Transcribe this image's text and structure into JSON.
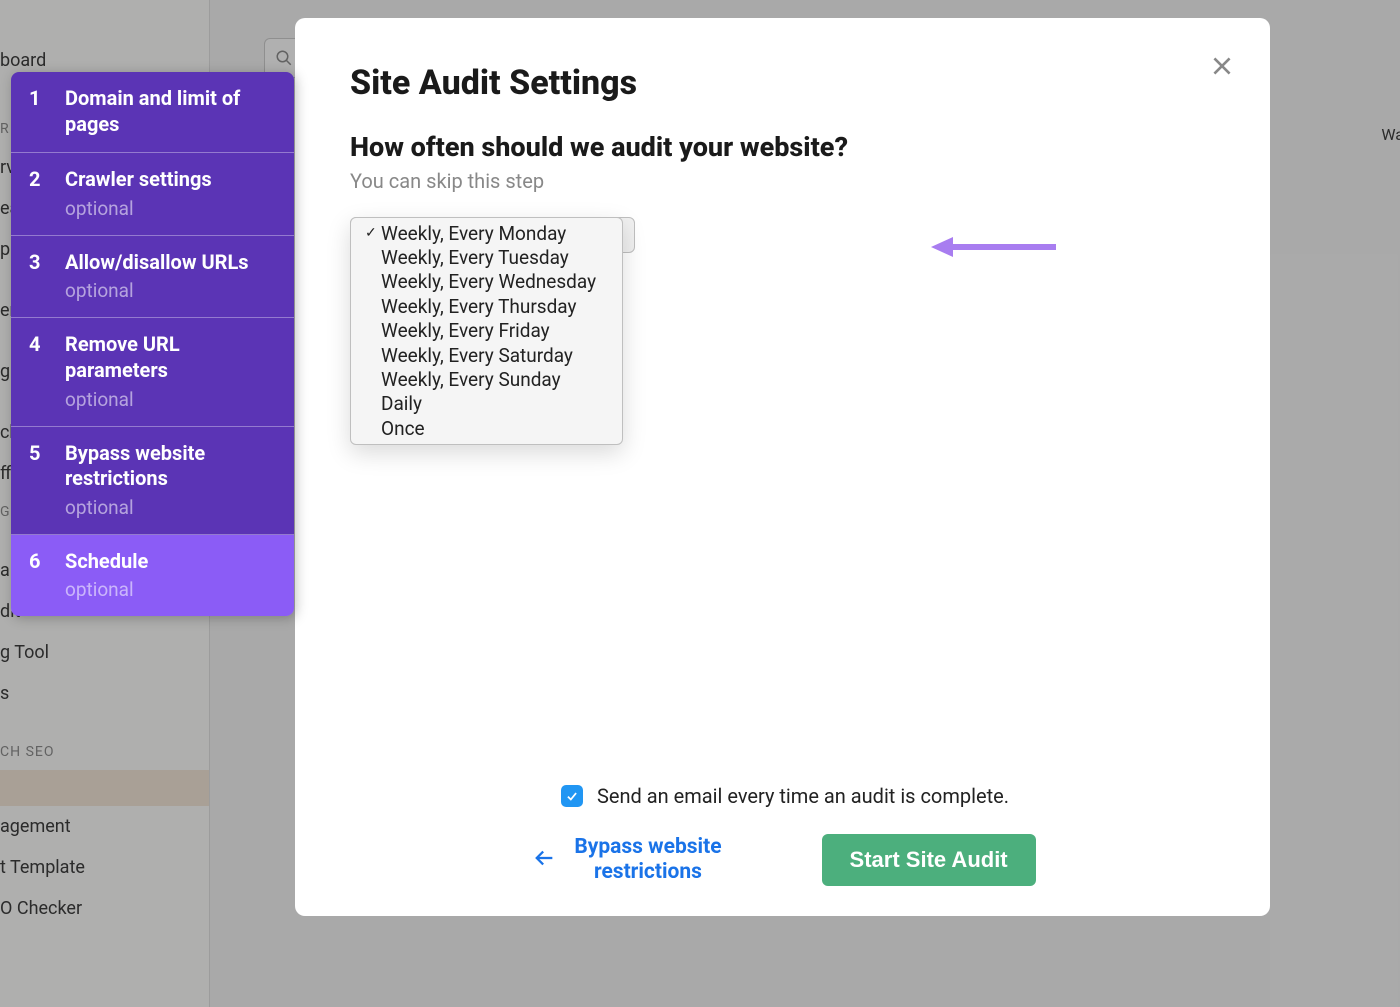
{
  "modal": {
    "title": "Site Audit Settings",
    "question": "How often should we audit your website?",
    "subtext": "You can skip this step"
  },
  "steps": [
    {
      "num": "1",
      "title": "Domain and limit of pages",
      "optional": ""
    },
    {
      "num": "2",
      "title": "Crawler settings",
      "optional": "optional"
    },
    {
      "num": "3",
      "title": "Allow/disallow URLs",
      "optional": "optional"
    },
    {
      "num": "4",
      "title": "Remove URL parameters",
      "optional": "optional"
    },
    {
      "num": "5",
      "title": "Bypass website restrictions",
      "optional": "optional"
    },
    {
      "num": "6",
      "title": "Schedule",
      "optional": "optional"
    }
  ],
  "active_step_index": 5,
  "dropdown": {
    "options": [
      "Weekly, Every Monday",
      "Weekly, Every Tuesday",
      "Weekly, Every Wednesday",
      "Weekly, Every Thursday",
      "Weekly, Every Friday",
      "Weekly, Every Saturday",
      "Weekly, Every Sunday",
      "Daily",
      "Once"
    ],
    "selected_index": 0
  },
  "footer": {
    "email_label": "Send an email every time an audit is complete.",
    "email_checked": true,
    "back_label": "Bypass website restrictions",
    "start_label": "Start Site Audit"
  },
  "bg_nav": [
    "board",
    "",
    "R",
    "rv",
    "ea",
    "p",
    "",
    "en",
    "",
    "g",
    "",
    "ck",
    "ffi",
    "G",
    "",
    "alytics",
    "dit",
    "g Tool",
    "s",
    "",
    "CH SEO",
    "",
    "agement",
    "t Template",
    "O Checker"
  ],
  "bg_right": "Wa",
  "colors": {
    "step_bg": "#5b34b5",
    "step_active": "#8b5cf6",
    "primary_green": "#4caf7d",
    "link_blue": "#1a73e8",
    "checkbox_blue": "#2196f3",
    "arrow_purple": "#a87df0"
  }
}
